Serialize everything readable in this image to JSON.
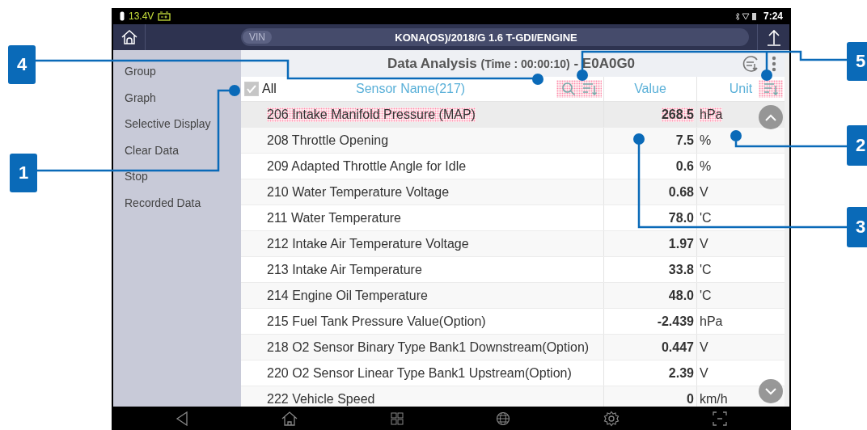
{
  "status_bar": {
    "voltage": "13.4V",
    "time": "7:24"
  },
  "header": {
    "vin_label": "VIN",
    "vehicle": "KONA(OS)/2018/G 1.6 T-GDI/ENGINE"
  },
  "sidebar": {
    "items": [
      "Group",
      "Graph",
      "Selective Display",
      "Clear Data",
      "Stop",
      "Recorded Data"
    ]
  },
  "title": {
    "title": "Data Analysis",
    "time": "(Time : 00:00:10)",
    "code": "- E0A0G0"
  },
  "table": {
    "select_all": {
      "label": "All",
      "checked": true
    },
    "columns": [
      "Sensor Name(217)",
      "Value",
      "Unit"
    ],
    "rows": [
      {
        "name": "206 Intake Manifold Pressure (MAP)",
        "value": "268.5",
        "unit": "hPa",
        "selected": true
      },
      {
        "name": "208 Throttle Opening",
        "value": "7.5",
        "unit": "%",
        "selected": false
      },
      {
        "name": "209 Adapted Throttle Angle for Idle",
        "value": "0.6",
        "unit": "%",
        "selected": false
      },
      {
        "name": "210 Water Temperature Voltage",
        "value": "0.68",
        "unit": "V",
        "selected": false
      },
      {
        "name": "211 Water Temperature",
        "value": "78.0",
        "unit": "'C",
        "selected": false
      },
      {
        "name": "212 Intake Air Temperature Voltage",
        "value": "1.97",
        "unit": "V",
        "selected": false
      },
      {
        "name": "213 Intake Air Temperature",
        "value": "33.8",
        "unit": "'C",
        "selected": false
      },
      {
        "name": "214 Engine Oil Temperature",
        "value": "48.0",
        "unit": "'C",
        "selected": false
      },
      {
        "name": "215 Fuel Tank Pressure Value(Option)",
        "value": "-2.439",
        "unit": "hPa",
        "selected": false
      },
      {
        "name": "218 O2 Sensor Binary Type Bank1 Downstream(Option)",
        "value": "0.447",
        "unit": "V",
        "selected": false
      },
      {
        "name": "220 O2 Sensor Linear Type Bank1 Upstream(Option)",
        "value": "2.39",
        "unit": "V",
        "selected": false
      },
      {
        "name": "222 Vehicle Speed",
        "value": "0",
        "unit": "km/h",
        "selected": false
      }
    ]
  },
  "callouts": [
    {
      "number": "4"
    },
    {
      "number": "1"
    },
    {
      "number": "5"
    },
    {
      "number": "2"
    },
    {
      "number": "3"
    }
  ]
}
